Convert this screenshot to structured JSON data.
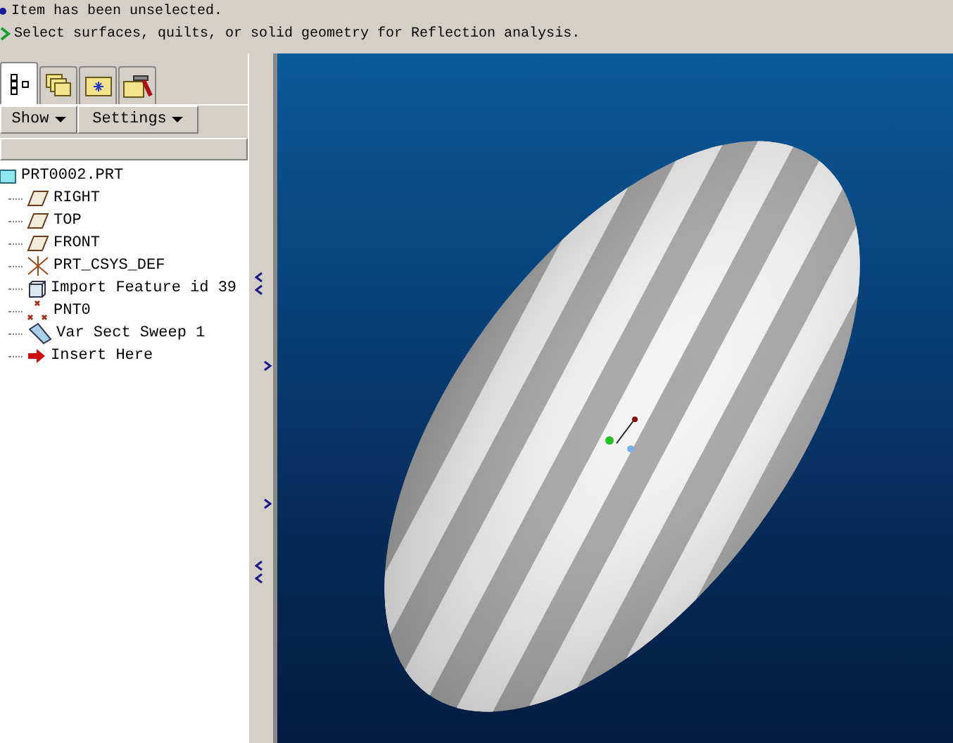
{
  "messages": [
    {
      "kind": "info",
      "text": "Item has been unselected."
    },
    {
      "kind": "prompt",
      "text": "Select surfaces, quilts, or solid geometry for Reflection analysis."
    }
  ],
  "tabs": [
    {
      "kind": "tree",
      "selected": true
    },
    {
      "kind": "layers",
      "selected": false
    },
    {
      "kind": "folder",
      "selected": false
    },
    {
      "kind": "tools",
      "selected": false
    }
  ],
  "menu_buttons": [
    "Show",
    "Settings"
  ],
  "tree": {
    "kind": "part",
    "label": "PRT0002.PRT",
    "expanded": true,
    "children": [
      {
        "kind": "plane",
        "label": "RIGHT"
      },
      {
        "kind": "plane",
        "label": "TOP"
      },
      {
        "kind": "plane",
        "label": "FRONT"
      },
      {
        "kind": "csys",
        "label": "PRT_CSYS_DEF"
      },
      {
        "kind": "feature",
        "label": "Import Feature id 39"
      },
      {
        "kind": "point",
        "label": "PNT0"
      },
      {
        "kind": "sweep",
        "label": "Var Sect Sweep 1"
      },
      {
        "kind": "insert",
        "label": "Insert Here"
      }
    ]
  }
}
